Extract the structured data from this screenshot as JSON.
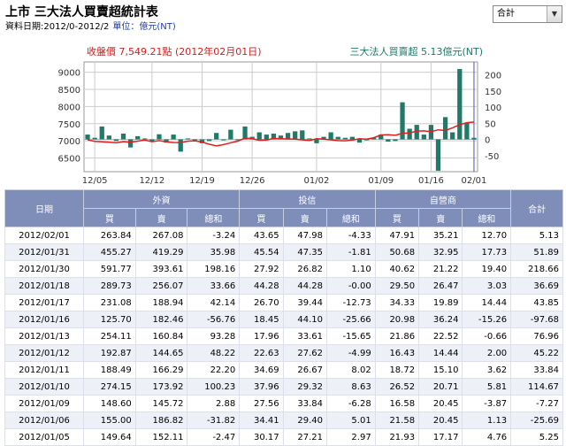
{
  "header": {
    "title": "上市 三大法人買賣超統計表",
    "date_range": "資料日期:2012/0-2012/2",
    "unit": "單位：億元(NT)"
  },
  "selector": {
    "selected": "合計"
  },
  "chart_data": {
    "type": "bar",
    "left_title": "收盤價 7,549.21點 (2012年02月01日)",
    "right_title": "三大法人買賣超 5.13億元(NT)",
    "left_axis": {
      "ticks": [
        6500,
        7000,
        7500,
        8000,
        8500,
        9000
      ],
      "range": [
        6100,
        9300
      ]
    },
    "right_axis": {
      "ticks": [
        -50,
        0,
        50,
        100,
        150,
        200
      ],
      "range": [
        -100,
        240
      ]
    },
    "x_tick_labels": [
      "12/05",
      "12/12",
      "12/19",
      "12/26",
      "01/02",
      "01/09",
      "01/16",
      "02/01"
    ],
    "colors": {
      "bar": "#1f7a6a",
      "line": "#e02020",
      "grid": "#cccccc",
      "cursor": "#5050c0"
    },
    "bar_values": [
      15,
      5,
      40,
      12,
      -5,
      18,
      -25,
      10,
      3,
      -8,
      16,
      -10,
      15,
      -38,
      3,
      0,
      -12,
      -5,
      20,
      0,
      30,
      0,
      40,
      8,
      22,
      15,
      18,
      12,
      20,
      25,
      28,
      3,
      -12,
      8,
      22,
      8,
      5,
      8,
      -10,
      0,
      5,
      15,
      -7,
      -5,
      115,
      33,
      45,
      15,
      45,
      -97,
      69,
      22,
      218,
      52,
      5
    ],
    "price_values": [
      7030,
      6985,
      6970,
      6960,
      6940,
      6975,
      6960,
      6990,
      7020,
      6975,
      7005,
      6970,
      6950,
      6945,
      6990,
      7000,
      6965,
      6900,
      6850,
      6890,
      6945,
      6990,
      7080,
      7060,
      7015,
      7025,
      7070,
      7060,
      7055,
      7050,
      7030,
      7010,
      7060,
      7050,
      7030,
      7005,
      7000,
      7020,
      7060,
      7050,
      7090,
      7170,
      7175,
      7160,
      7220,
      7230,
      7280,
      7290,
      7270,
      7320,
      7300,
      7380,
      7470,
      7530,
      7549
    ]
  },
  "table": {
    "group_headers": [
      "日期",
      "外資",
      "投信",
      "自營商",
      "合計"
    ],
    "sub_headers": [
      "買",
      "賣",
      "總和",
      "買",
      "賣",
      "總和",
      "買",
      "賣",
      "總和"
    ],
    "rows": [
      [
        "2012/02/01",
        "263.84",
        "267.08",
        "-3.24",
        "43.65",
        "47.98",
        "-4.33",
        "47.91",
        "35.21",
        "12.70",
        "5.13"
      ],
      [
        "2012/01/31",
        "455.27",
        "419.29",
        "35.98",
        "45.54",
        "47.35",
        "-1.81",
        "50.68",
        "32.95",
        "17.73",
        "51.89"
      ],
      [
        "2012/01/30",
        "591.77",
        "393.61",
        "198.16",
        "27.92",
        "26.82",
        "1.10",
        "40.62",
        "21.22",
        "19.40",
        "218.66"
      ],
      [
        "2012/01/18",
        "289.73",
        "256.07",
        "33.66",
        "44.28",
        "44.28",
        "-0.00",
        "29.50",
        "26.47",
        "3.03",
        "36.69"
      ],
      [
        "2012/01/17",
        "231.08",
        "188.94",
        "42.14",
        "26.70",
        "39.44",
        "-12.73",
        "34.33",
        "19.89",
        "14.44",
        "43.85"
      ],
      [
        "2012/01/16",
        "125.70",
        "182.46",
        "-56.76",
        "18.45",
        "44.10",
        "-25.66",
        "20.98",
        "36.24",
        "-15.26",
        "-97.68"
      ],
      [
        "2012/01/13",
        "254.11",
        "160.84",
        "93.28",
        "17.96",
        "33.61",
        "-15.65",
        "21.86",
        "22.52",
        "-0.66",
        "76.96"
      ],
      [
        "2012/01/12",
        "192.87",
        "144.65",
        "48.22",
        "22.63",
        "27.62",
        "-4.99",
        "16.43",
        "14.44",
        "2.00",
        "45.22"
      ],
      [
        "2012/01/11",
        "188.49",
        "166.29",
        "22.20",
        "34.69",
        "26.67",
        "8.02",
        "18.72",
        "15.10",
        "3.62",
        "33.84"
      ],
      [
        "2012/01/10",
        "274.15",
        "173.92",
        "100.23",
        "37.96",
        "29.32",
        "8.63",
        "26.52",
        "20.71",
        "5.81",
        "114.67"
      ],
      [
        "2012/01/09",
        "148.60",
        "145.72",
        "2.88",
        "27.56",
        "33.84",
        "-6.28",
        "16.58",
        "20.45",
        "-3.87",
        "-7.27"
      ],
      [
        "2012/01/06",
        "155.00",
        "186.82",
        "-31.82",
        "34.41",
        "29.40",
        "5.01",
        "21.58",
        "20.45",
        "1.13",
        "-25.69"
      ],
      [
        "2012/01/05",
        "149.64",
        "152.11",
        "-2.47",
        "30.17",
        "27.21",
        "2.97",
        "21.93",
        "17.17",
        "4.76",
        "5.25"
      ]
    ]
  }
}
